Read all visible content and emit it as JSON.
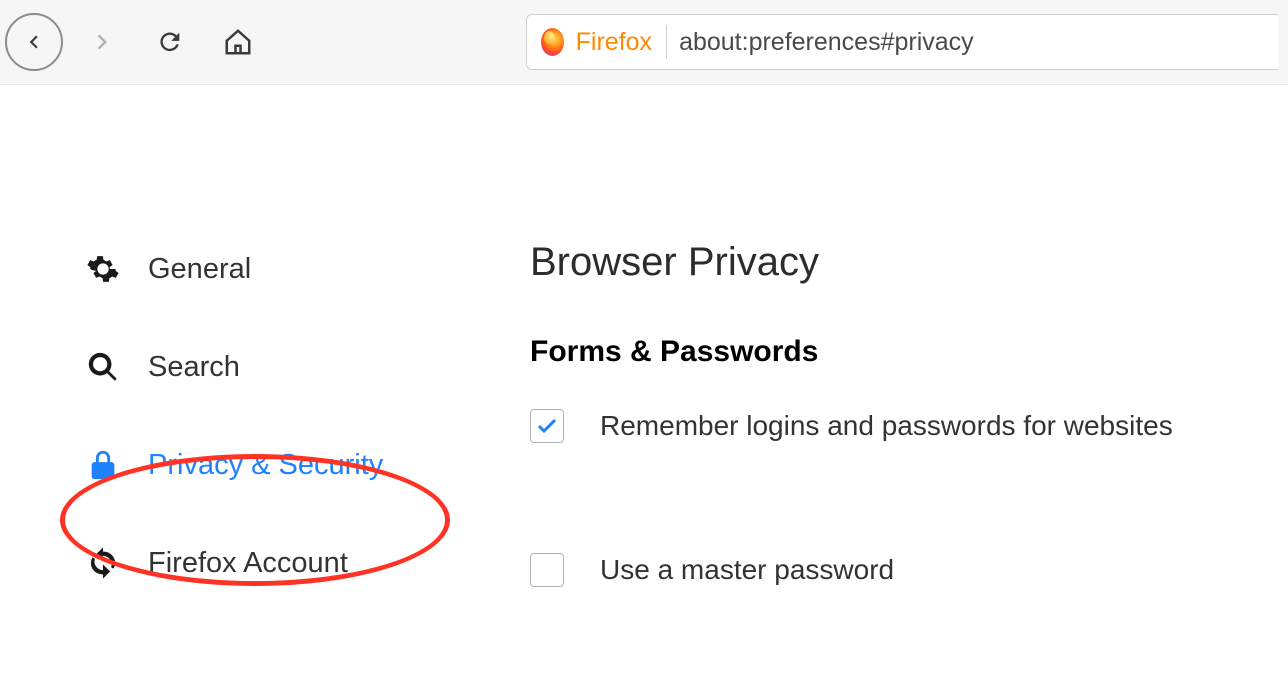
{
  "toolbar": {
    "address_badge": "Firefox",
    "url": "about:preferences#privacy"
  },
  "sidebar": {
    "items": [
      {
        "label": "General",
        "icon": "gear-icon",
        "active": false
      },
      {
        "label": "Search",
        "icon": "search-icon",
        "active": false
      },
      {
        "label": "Privacy & Security",
        "icon": "lock-icon",
        "active": true,
        "highlighted": true
      },
      {
        "label": "Firefox Account",
        "icon": "sync-icon",
        "active": false
      }
    ]
  },
  "main": {
    "page_title": "Browser Privacy",
    "section_heading": "Forms & Passwords",
    "options": [
      {
        "label": "Remember logins and passwords for websites",
        "checked": true
      },
      {
        "label": "Use a master password",
        "checked": false
      }
    ]
  }
}
